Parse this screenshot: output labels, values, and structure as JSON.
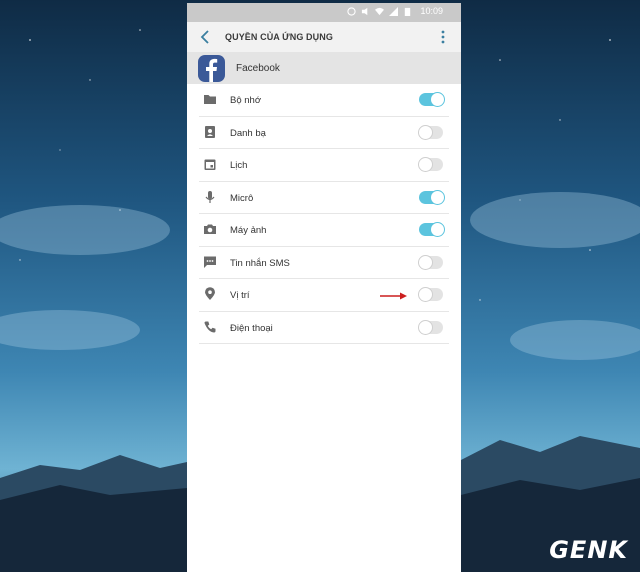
{
  "status_bar": {
    "time": "10:09"
  },
  "app_bar": {
    "title": "QUYỀN CỦA ỨNG DỤNG"
  },
  "app": {
    "name": "Facebook"
  },
  "colors": {
    "toggle_on": "#5cc4de",
    "toggle_off": "#e3e3e3",
    "arrow": "#cc1f1f",
    "fb_blue": "#3b5998"
  },
  "permissions": [
    {
      "label": "Bộ nhớ",
      "icon": "folder-icon",
      "enabled": true
    },
    {
      "label": "Danh bạ",
      "icon": "contacts-icon",
      "enabled": false
    },
    {
      "label": "Lịch",
      "icon": "calendar-icon",
      "enabled": false
    },
    {
      "label": "Micrô",
      "icon": "microphone-icon",
      "enabled": true
    },
    {
      "label": "Máy ảnh",
      "icon": "camera-icon",
      "enabled": true
    },
    {
      "label": "Tin nhắn SMS",
      "icon": "sms-icon",
      "enabled": false
    },
    {
      "label": "Vị trí",
      "icon": "location-icon",
      "enabled": false
    },
    {
      "label": "Điện thoại",
      "icon": "phone-icon",
      "enabled": false
    }
  ],
  "watermark": {
    "text": "GENK"
  }
}
